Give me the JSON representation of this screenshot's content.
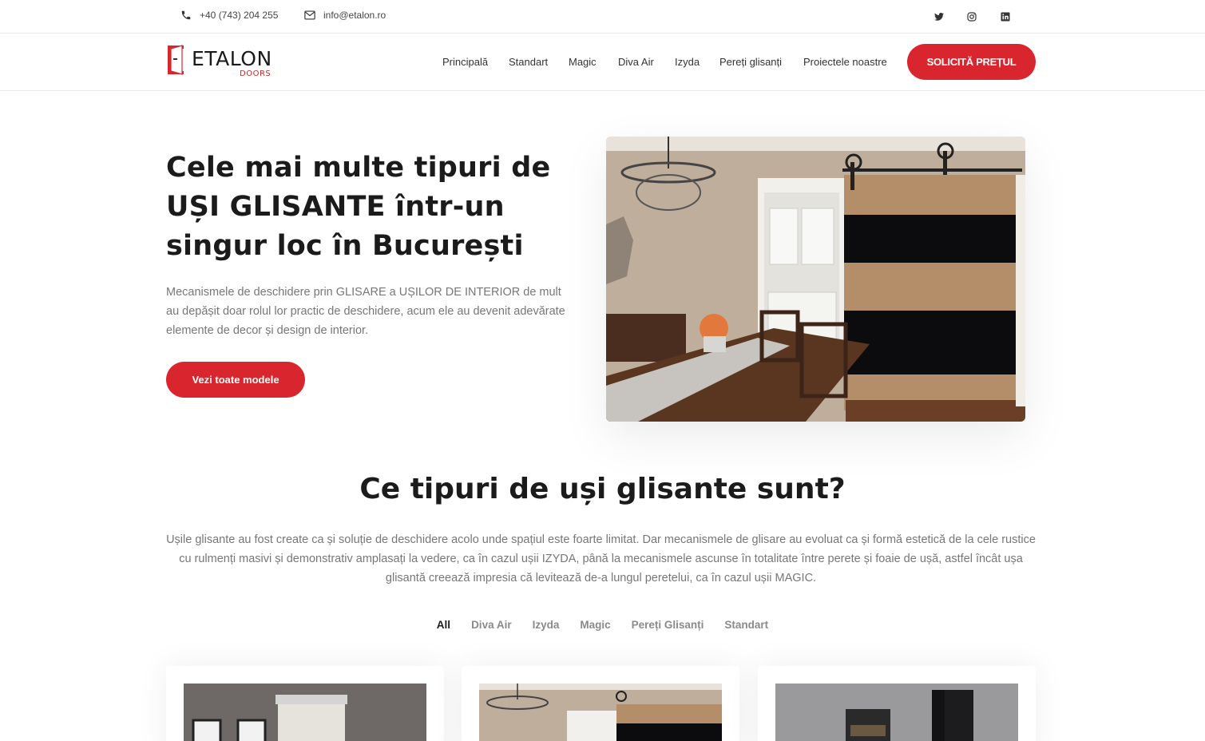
{
  "topbar": {
    "phone": "+40 (743) 204 255",
    "email": "info@etalon.ro",
    "social": [
      "twitter-icon",
      "instagram-icon",
      "linkedin-icon"
    ]
  },
  "header": {
    "logo_word": "ETALON",
    "logo_sub": "DOORS",
    "nav": [
      "Principală",
      "Standart",
      "Magic",
      "Diva Air",
      "Izyda",
      "Pereți glisanți",
      "Proiectele noastre"
    ],
    "cta": "SOLICITĂ PREȚUL"
  },
  "hero": {
    "title": "Cele mai multe tipuri de UȘI GLISANTE într-un singur loc în București",
    "description": "Mecanismele de deschidere prin GLISARE a UȘILOR DE INTERIOR de mult au depășit doar rolul lor practic de deschidere, acum ele au devenit adevărate elemente de decor și design de interior.",
    "button": "Vezi toate modele"
  },
  "section": {
    "title": "Ce tipuri de uși glisante sunt?",
    "description": "Ușile glisante au fost create ca și soluție de deschidere acolo unde spațiul este foarte limitat. Dar mecanismele de glisare au evoluat ca și formă estetică de la cele rustice cu rulmenți masivi și demonstrativ amplasați la vedere, ca în cazul ușii IZYDA, până la mecanismele ascunse în totalitate între perete și foaie de ușă, astfel încât ușa glisantă creează impresia că levitează de-a lungul peretelui, ca în cazul ușii MAGIC.",
    "filters": [
      "All",
      "Diva Air",
      "Izyda",
      "Magic",
      "Pereți Glisanți",
      "Standart"
    ],
    "active_filter": "All"
  },
  "colors": {
    "accent": "#d9262e",
    "heading": "#1b1b1b",
    "body_text": "#777777"
  }
}
